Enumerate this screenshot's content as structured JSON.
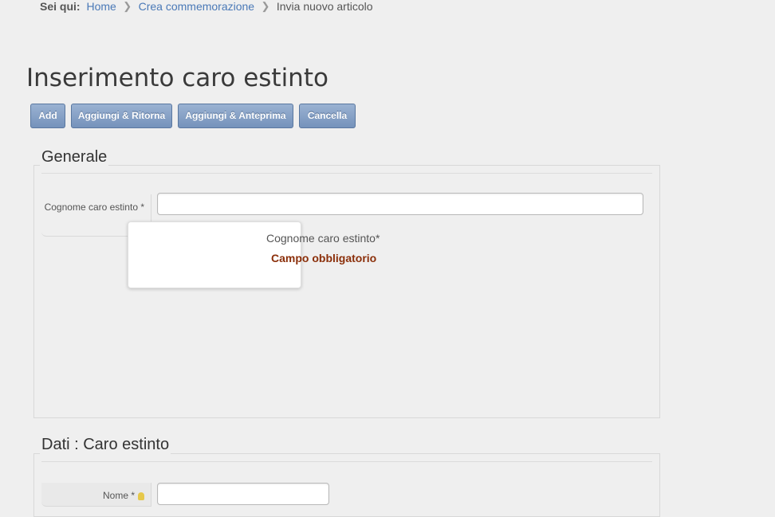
{
  "breadcrumb": {
    "label": "Sei qui:",
    "items": [
      "Home",
      "Crea commemorazione",
      "Invia nuovo articolo"
    ],
    "separator": ">"
  },
  "page_title": "Inserimento caro estinto",
  "toolbar": {
    "add": "Add",
    "save_return": "Aggiungi & Ritorna",
    "save_preview": "Aggiungi & Anteprima",
    "cancel": "Cancella"
  },
  "sections": {
    "generale": {
      "legend": "Generale",
      "cognome_label": "Cognome caro estinto *",
      "cognome_value": ""
    },
    "dati": {
      "legend": "Dati : Caro estinto",
      "nome_label": "Nome *",
      "nome_value": ""
    }
  },
  "tooltip": {
    "title": "Cognome caro estinto*",
    "message": "Campo obbligatorio"
  },
  "colors": {
    "link": "#4a79b7",
    "button": "#7592bb",
    "error": "#8b2f0a"
  },
  "icons": {
    "separator": "chevron-right-icon",
    "hint": "lightbulb-icon"
  }
}
